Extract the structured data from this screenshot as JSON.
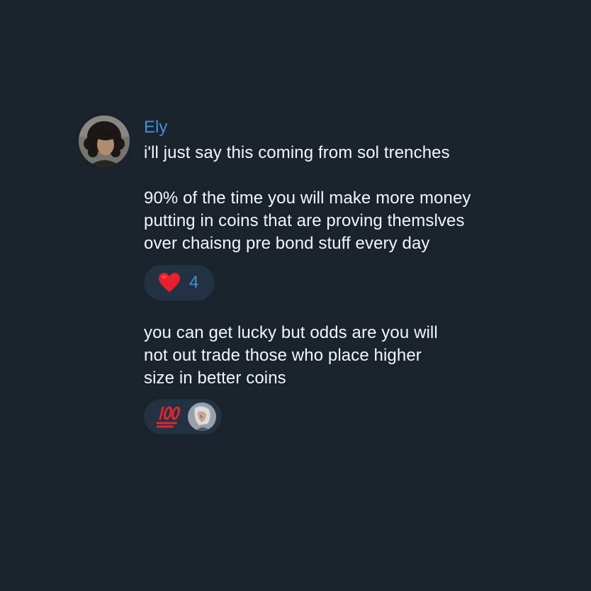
{
  "message_group": {
    "author": {
      "name": "Ely",
      "avatar_icon": "user-avatar-curly-hair",
      "name_color": "#3e93d6"
    },
    "messages": [
      {
        "lines": [
          "i'll just say this coming from sol trenches"
        ]
      },
      {
        "lines": [
          "90% of the time you will make more money",
          "putting in coins that are proving themslves",
          "over chaisng pre bond stuff every day"
        ],
        "reaction": {
          "emoji_icon": "red-heart-emoji",
          "count": "4"
        }
      },
      {
        "lines": [
          "you can get lucky but odds are you will",
          "not out trade those who place higher",
          "size in better coins"
        ],
        "reaction": {
          "emoji_icon": "hundred-points-emoji",
          "reactor_avatar_icon": "reactor-avatar-illustration"
        }
      }
    ]
  },
  "colors": {
    "background": "#1a222c",
    "reaction_bg": "#233242",
    "accent": "#3e93d6",
    "text": "#f5f7f9"
  }
}
